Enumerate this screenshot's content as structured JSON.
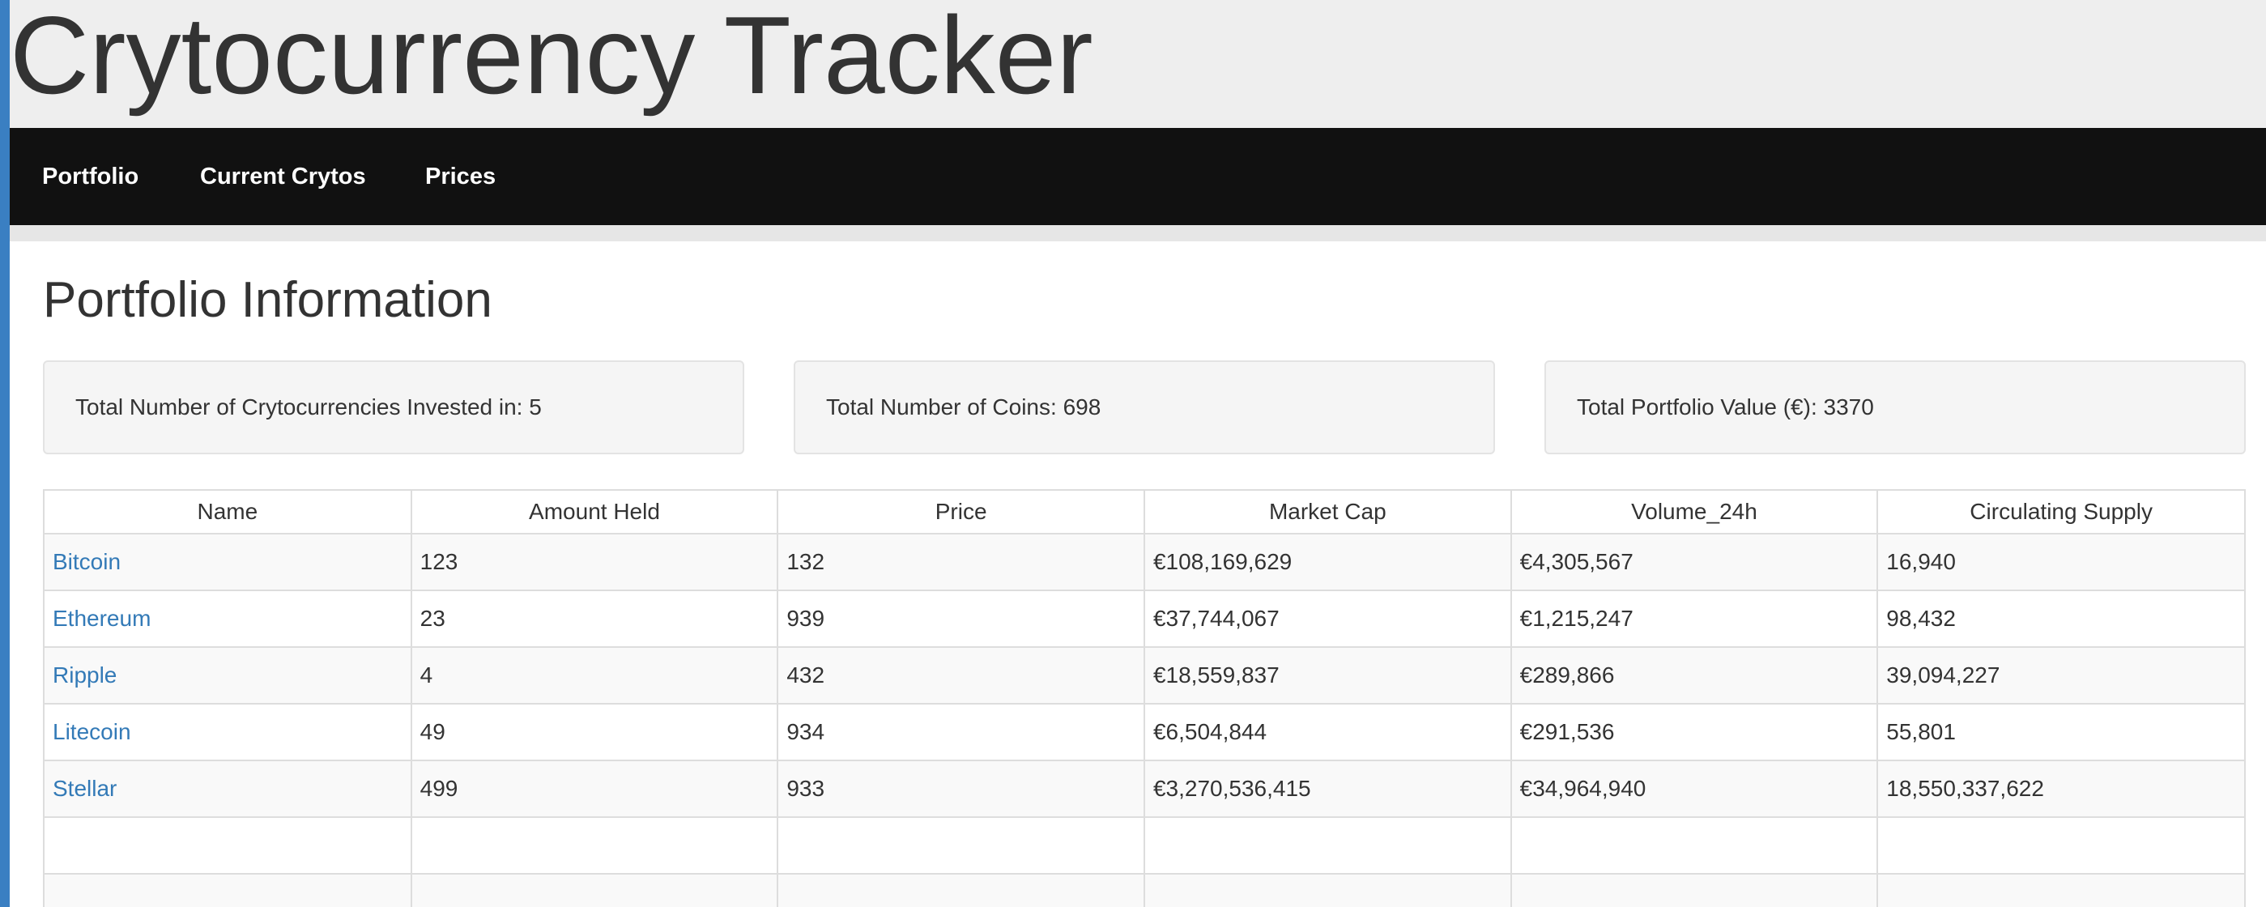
{
  "app": {
    "title": "Crytocurrency Tracker"
  },
  "nav": {
    "items": [
      {
        "label": "Portfolio"
      },
      {
        "label": "Current Crytos"
      },
      {
        "label": "Prices"
      }
    ]
  },
  "main": {
    "section_title": "Portfolio Information",
    "stats": [
      {
        "text": "Total Number of Crytocurrencies Invested in: 5"
      },
      {
        "text": "Total Number of Coins: 698"
      },
      {
        "text": "Total Portfolio Value (€): 3370"
      }
    ],
    "table": {
      "columns": [
        "Name",
        "Amount Held",
        "Price",
        "Market Cap",
        "Volume_24h",
        "Circulating Supply"
      ],
      "rows": [
        [
          "Bitcoin",
          "123",
          "132",
          "€108,169,629",
          "€4,305,567",
          "16,940"
        ],
        [
          "Ethereum",
          "23",
          "939",
          "€37,744,067",
          "€1,215,247",
          "98,432"
        ],
        [
          "Ripple",
          "4",
          "432",
          "€18,559,837",
          "€289,866",
          "39,094,227"
        ],
        [
          "Litecoin",
          "49",
          "934",
          "€6,504,844",
          "€291,536",
          "55,801"
        ],
        [
          "Stellar",
          "499",
          "933",
          "€3,270,536,415",
          "€34,964,940",
          "18,550,337,622"
        ],
        [
          "",
          "",
          "",
          "",
          "",
          ""
        ],
        [
          "",
          "",
          "",
          "",
          "",
          ""
        ]
      ]
    }
  },
  "colors": {
    "accent_bar": "#3a7fc2",
    "navbar_bg": "#111111",
    "header_bg": "#eeeeee",
    "link": "#337ab7",
    "card_bg": "#f5f5f5"
  }
}
